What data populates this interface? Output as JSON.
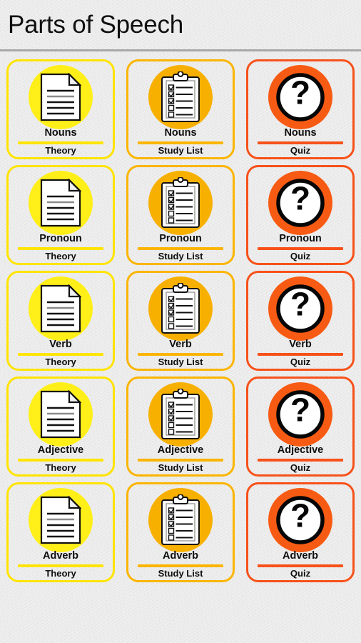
{
  "header": {
    "title": "Parts of Speech"
  },
  "colors": {
    "theory_accent": "#ffe400",
    "theory_circle": "#ffef19",
    "study_accent": "#fbb500",
    "study_circle": "#f8b000",
    "quiz_accent": "#f7511a",
    "quiz_circle": "#f75b13",
    "background": "#f1f1f1",
    "divider": "#a8a8a8",
    "text": "#0d0d0d"
  },
  "columns": [
    {
      "key": "theory",
      "sub_label": "Theory",
      "icon": "document-icon"
    },
    {
      "key": "study",
      "sub_label": "Study List",
      "icon": "clipboard-checklist-icon"
    },
    {
      "key": "quiz",
      "sub_label": "Quiz",
      "icon": "question-mark-icon"
    }
  ],
  "rows": [
    {
      "title": "Nouns"
    },
    {
      "title": "Pronoun"
    },
    {
      "title": "Verb"
    },
    {
      "title": "Adjective"
    },
    {
      "title": "Adverb"
    }
  ],
  "cards": [
    {
      "title": "Nouns",
      "sub_label": "Theory",
      "icon": "document-icon",
      "column": "theory"
    },
    {
      "title": "Nouns",
      "sub_label": "Study List",
      "icon": "clipboard-checklist-icon",
      "column": "study"
    },
    {
      "title": "Nouns",
      "sub_label": "Quiz",
      "icon": "question-mark-icon",
      "column": "quiz"
    },
    {
      "title": "Pronoun",
      "sub_label": "Theory",
      "icon": "document-icon",
      "column": "theory"
    },
    {
      "title": "Pronoun",
      "sub_label": "Study List",
      "icon": "clipboard-checklist-icon",
      "column": "study"
    },
    {
      "title": "Pronoun",
      "sub_label": "Quiz",
      "icon": "question-mark-icon",
      "column": "quiz"
    },
    {
      "title": "Verb",
      "sub_label": "Theory",
      "icon": "document-icon",
      "column": "theory"
    },
    {
      "title": "Verb",
      "sub_label": "Study List",
      "icon": "clipboard-checklist-icon",
      "column": "study"
    },
    {
      "title": "Verb",
      "sub_label": "Quiz",
      "icon": "question-mark-icon",
      "column": "quiz"
    },
    {
      "title": "Adjective",
      "sub_label": "Theory",
      "icon": "document-icon",
      "column": "theory"
    },
    {
      "title": "Adjective",
      "sub_label": "Study List",
      "icon": "clipboard-checklist-icon",
      "column": "study"
    },
    {
      "title": "Adjective",
      "sub_label": "Quiz",
      "icon": "question-mark-icon",
      "column": "quiz"
    },
    {
      "title": "Adverb",
      "sub_label": "Theory",
      "icon": "document-icon",
      "column": "theory"
    },
    {
      "title": "Adverb",
      "sub_label": "Study List",
      "icon": "clipboard-checklist-icon",
      "column": "study"
    },
    {
      "title": "Adverb",
      "sub_label": "Quiz",
      "icon": "question-mark-icon",
      "column": "quiz"
    }
  ]
}
